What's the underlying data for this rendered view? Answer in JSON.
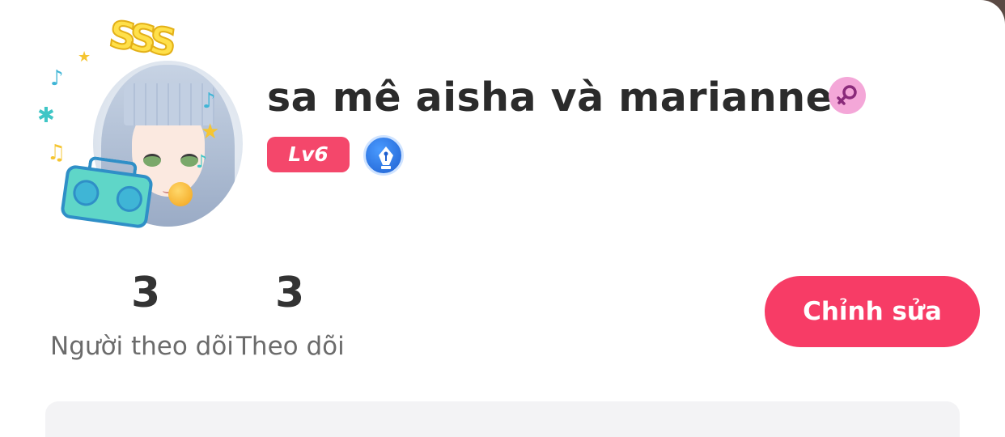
{
  "profile": {
    "username": "sa mê aisha và marianne",
    "gender_icon": "female-symbol-icon",
    "level_label": "Lv6",
    "badge_icon": "pen-nib-icon",
    "avatar_icon": "avatar-frame-sss-music"
  },
  "stats": {
    "followers_count": "3",
    "followers_label": "Người theo dõi",
    "following_count": "3",
    "following_label": "Theo dõi"
  },
  "actions": {
    "edit_label": "Chỉnh sửa"
  },
  "colors": {
    "accent": "#f73c66",
    "level_badge": "#f4476b",
    "gender_badge": "#f4a7d8",
    "writer_badge": "#1e5fd0",
    "text_primary": "#2b2b2b",
    "text_secondary": "#6b6b6b"
  }
}
